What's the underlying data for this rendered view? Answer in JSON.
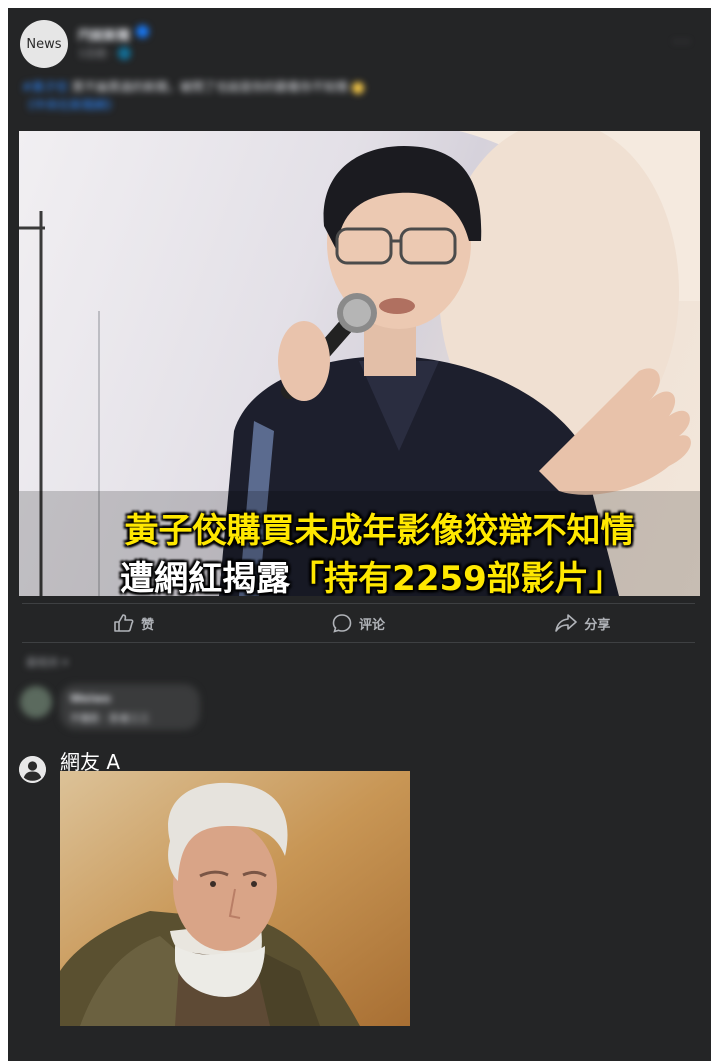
{
  "post": {
    "page_avatar_label": "News",
    "page_name": "円就新聞",
    "meta": "1日前 · 🌐",
    "hashtag": "#黃子佼",
    "text": " 買不論買過的新聞，被問了也說是你的觀看你不知情",
    "link_text": "《中央社新聞網》",
    "more": "···"
  },
  "photo": {
    "caption_line1": "黃子佼購買未成年影像狡辯不知情",
    "caption_line2_prefix": "遭網紅揭露",
    "caption_line2_highlight": "「持有2259部影片」"
  },
  "actions": {
    "like": "赞",
    "comment": "评论",
    "share": "分享"
  },
  "comments": {
    "filter": "最相关 ▾",
    "first": {
      "name": "Weiwo",
      "text": "不雅影 · 影者三三"
    },
    "second": {
      "name": "網友 A"
    }
  },
  "colors": {
    "card_bg": "#242526",
    "accent_blue": "#2d88ff",
    "caption_yellow": "#ffe800"
  }
}
